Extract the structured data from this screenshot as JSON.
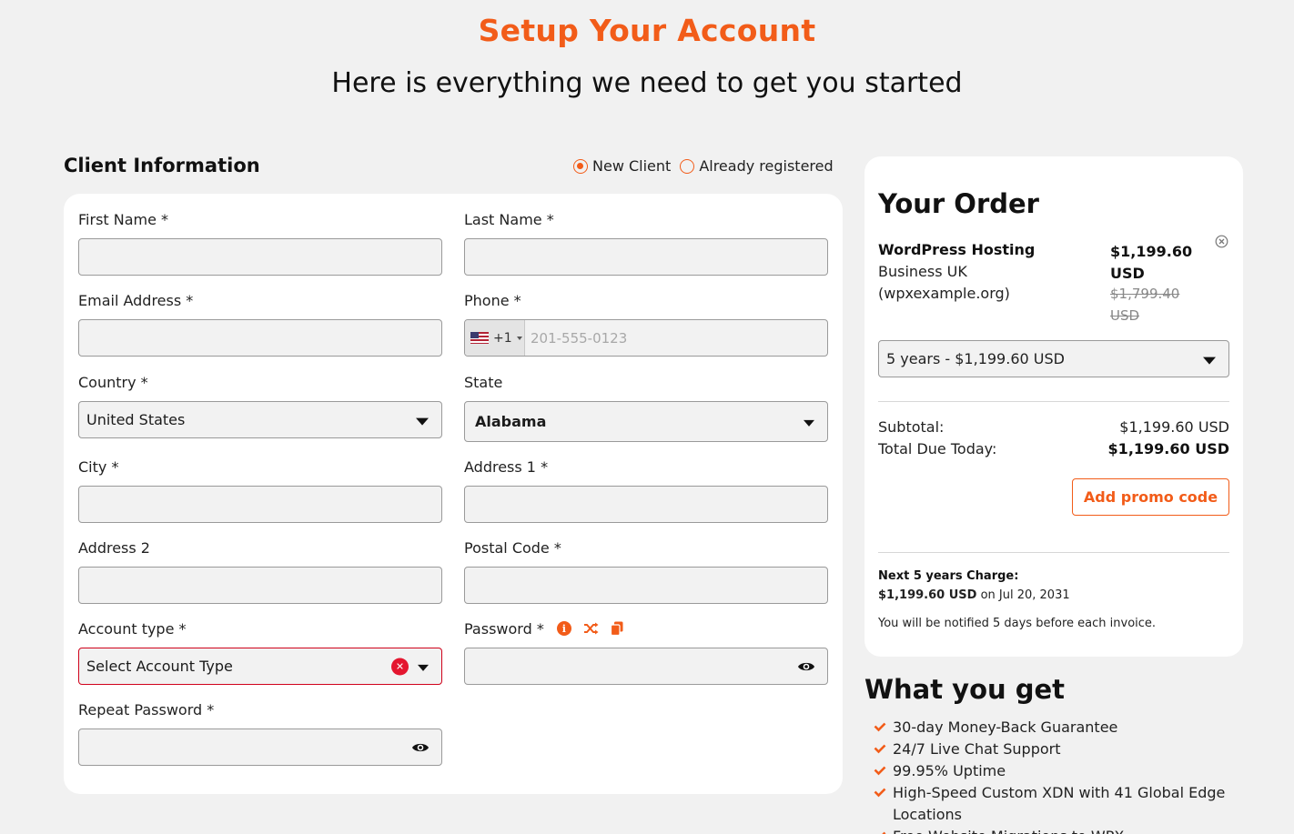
{
  "page": {
    "title": "Setup Your Account",
    "subtitle": "Here is everything we need to get you started"
  },
  "client_info": {
    "heading": "Client Information",
    "toggle": {
      "new_client": "New Client",
      "already_registered": "Already registered",
      "selected": "new_client"
    }
  },
  "form": {
    "first_name_label": "First Name *",
    "last_name_label": "Last Name *",
    "email_label": "Email Address *",
    "phone_label": "Phone *",
    "phone_country_code": "+1",
    "phone_placeholder": "201-555-0123",
    "country_label": "Country *",
    "country_value": "United States",
    "state_label": "State",
    "state_value": "Alabama",
    "city_label": "City *",
    "address1_label": "Address 1 *",
    "address2_label": "Address 2",
    "postal_code_label": "Postal Code *",
    "account_type_label": "Account type *",
    "account_type_value": "Select Account Type",
    "password_label": "Password *",
    "repeat_password_label": "Repeat Password *"
  },
  "order": {
    "title": "Your Order",
    "product_name": "WordPress Hosting",
    "product_plan": "Business UK",
    "product_domain": "(wpxexample.org)",
    "price": "$1,199.60 USD",
    "original_price": "$1,799.40 USD",
    "term_selected": "5 years - $1,199.60 USD",
    "subtotal_label": "Subtotal:",
    "subtotal_value": "$1,199.60 USD",
    "total_label": "Total Due Today:",
    "total_value": "$1,199.60 USD",
    "promo_button": "Add promo code",
    "next_charge_label": "Next 5 years Charge:",
    "next_charge_amount": "$1,199.60 USD",
    "next_charge_date": "on Jul 20, 2031",
    "notify_text": "You will be notified 5 days before each invoice."
  },
  "what_you_get": {
    "title": "What you get",
    "items": [
      "30-day Money-Back Guarantee",
      "24/7 Live Chat Support",
      "99.95% Uptime",
      "High-Speed Custom XDN with 41 Global Edge Locations",
      "Free Website Migrations to WPX"
    ]
  },
  "colors": {
    "accent": "#f25c19",
    "error": "#d0021b",
    "background": "#f1f1f1"
  }
}
